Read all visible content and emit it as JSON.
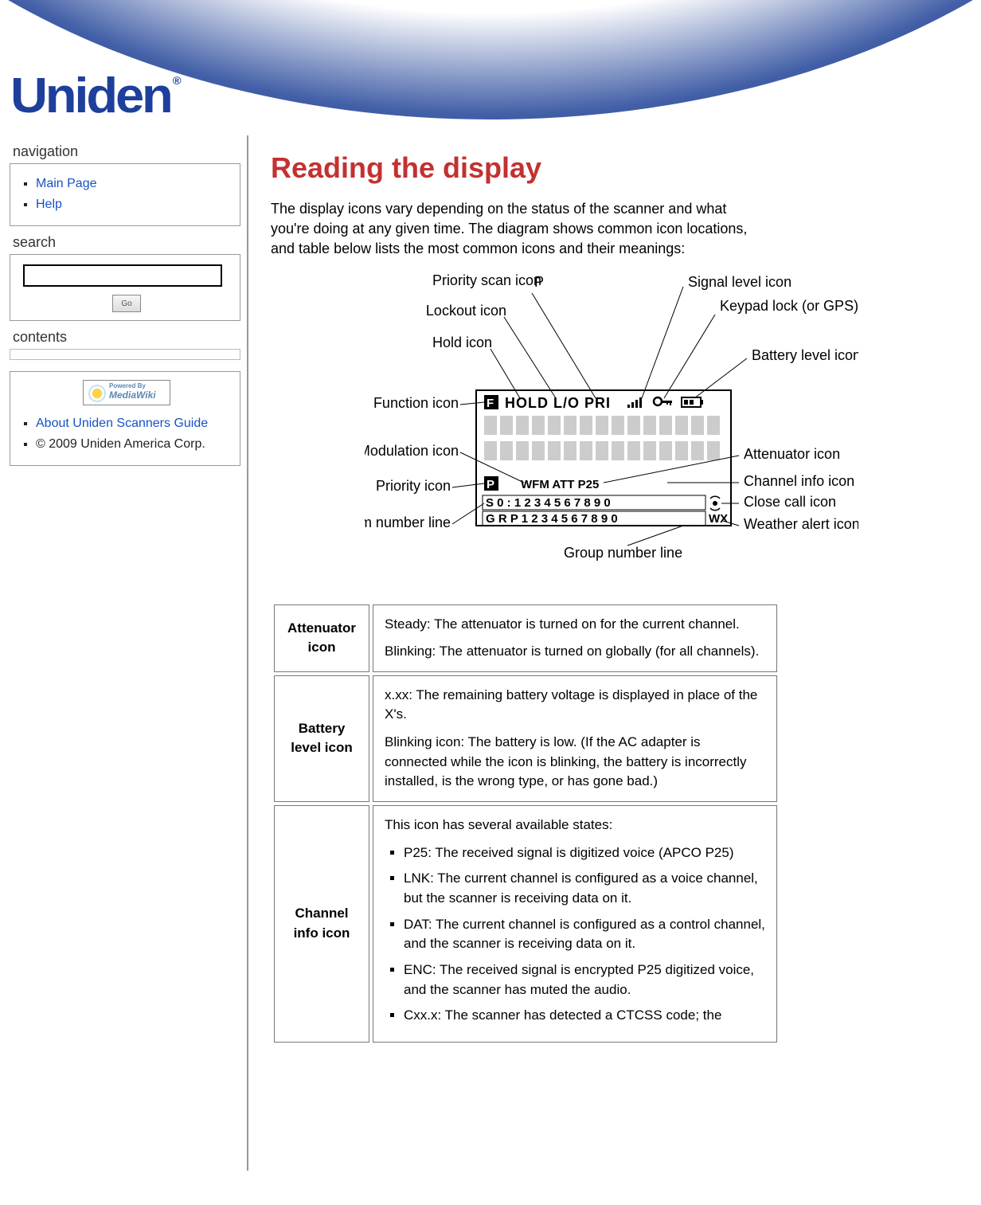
{
  "logo_text": "Uniden",
  "logo_reg": "®",
  "sidebar": {
    "nav_heading": "navigation",
    "nav_items": [
      {
        "label": "Main Page",
        "link": true
      },
      {
        "label": "Help",
        "link": true
      }
    ],
    "search_heading": "search",
    "search_value": "",
    "go_label": "Go",
    "contents_heading": "contents",
    "powered_by_top": "Powered By",
    "powered_by_bottom": "MediaWiki",
    "footer_items": [
      {
        "label": "About Uniden Scanners Guide",
        "link": true
      },
      {
        "label": "© 2009 Uniden America Corp.",
        "link": false
      }
    ]
  },
  "page": {
    "title": "Reading the display",
    "intro": "The display icons vary depending on the status of the scanner and what you're doing at any given time. The diagram shows common icon locations, and table below lists the most common icons and their meanings:"
  },
  "diagram": {
    "callouts_left": [
      "Priority scan icon",
      "Lockout icon",
      "Hold icon",
      "Function icon",
      "Modulation icon",
      "Priority icon",
      "System number line"
    ],
    "callouts_right": [
      "Signal level icon",
      "Keypad lock (or GPS) icon",
      "Battery level icon",
      "Attenuator icon",
      "Channel info icon",
      "Close call icon",
      "Weather alert icon"
    ],
    "callout_bottom": "Group number line",
    "lcd_top_row": "HOLD  L/O    PRI",
    "lcd_mid_row": "WFM      ATT      P25",
    "lcd_sys_row": "S 0 : 1 2 3 4 5 6 7 8 9 0",
    "lcd_grp_row": "G R P 1 2 3 4 5 6 7 8 9 0",
    "lcd_wx": "WX",
    "lcd_f": "F",
    "lcd_p": "P"
  },
  "table": {
    "rows": [
      {
        "label": "Attenuator icon",
        "paras": [
          "Steady: The attenuator is turned on for the current channel.",
          "Blinking: The attenuator is turned on globally (for all channels)."
        ]
      },
      {
        "label": "Battery level icon",
        "paras": [
          "x.xx: The remaining battery voltage is displayed in place of the X's.",
          "Blinking icon: The battery is low. (If the AC adapter is connected while the icon is blinking, the battery is incorrectly installed, is the wrong type, or has gone bad.)"
        ]
      },
      {
        "label": "Channel info icon",
        "intro": "This icon has several available states:",
        "items": [
          "P25: The received signal is digitized voice (APCO P25)",
          "LNK: The current channel is configured as a voice channel, but the scanner is receiving data on it.",
          "DAT: The current channel is configured as a control channel, and the scanner is receiving data on it.",
          "ENC: The received signal is encrypted P25 digitized voice, and the scanner has muted the audio.",
          "Cxx.x: The scanner has detected a CTCSS code; the"
        ]
      }
    ]
  }
}
